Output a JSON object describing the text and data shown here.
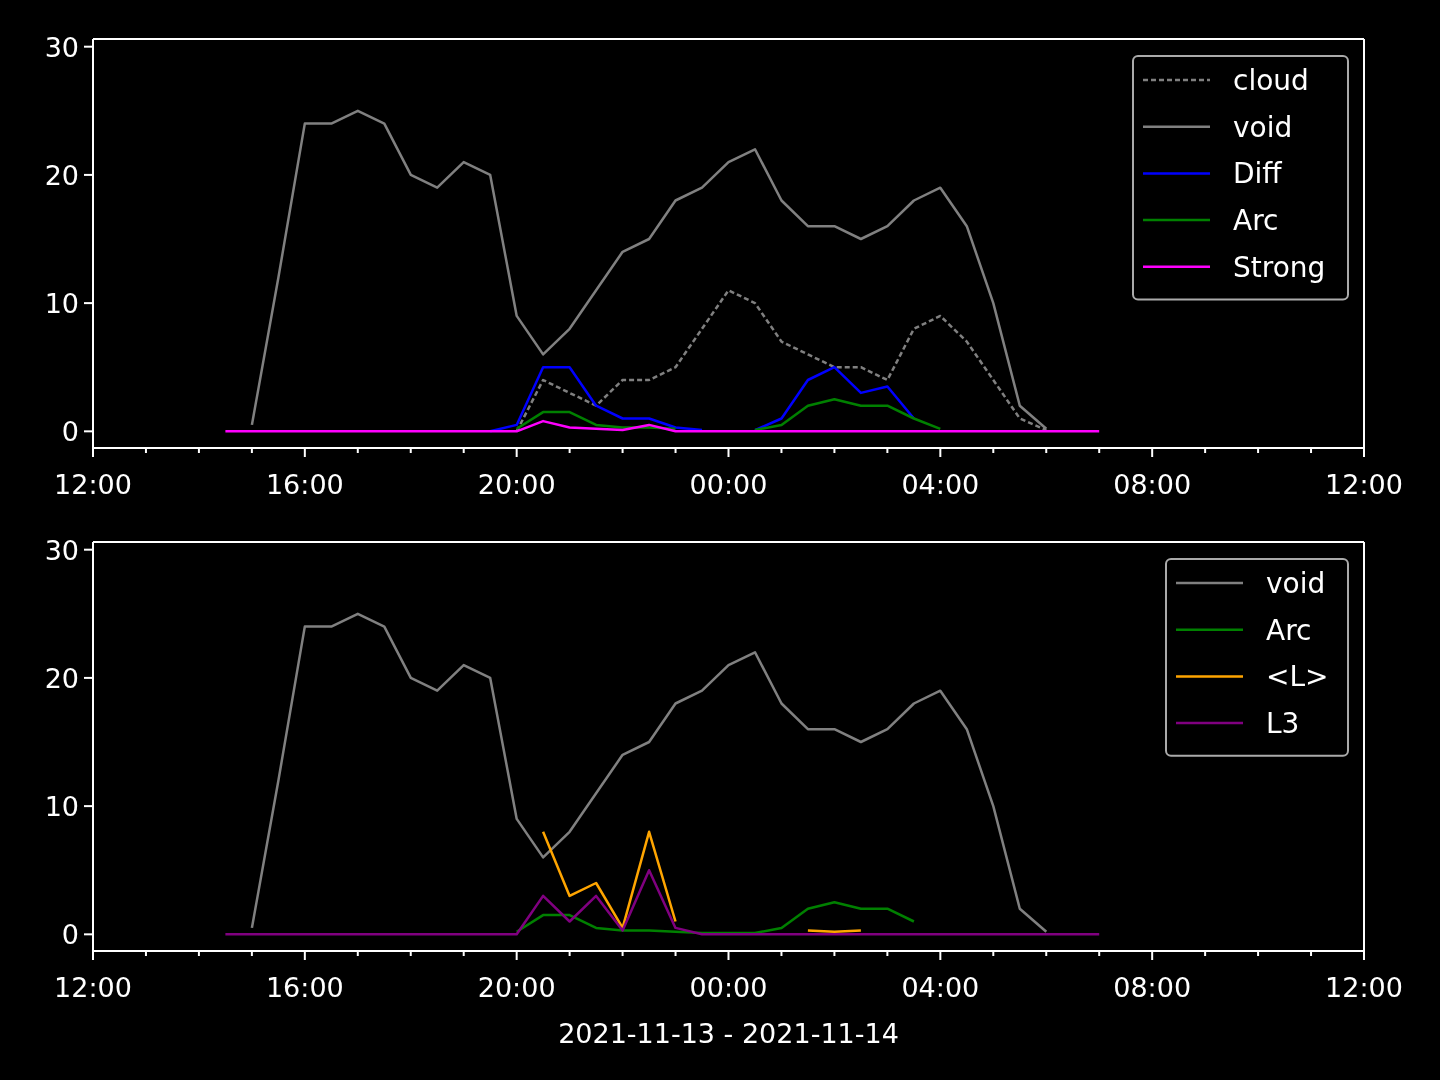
{
  "charts": [
    {
      "chart_data": {
        "type": "line",
        "ylim": [
          -1.3,
          30.6
        ],
        "legend": "upper right",
        "categories": [
          "12:00",
          null,
          null,
          null,
          null,
          null,
          null,
          null,
          "16:00",
          null,
          null,
          null,
          null,
          null,
          null,
          null,
          "20:00",
          null,
          null,
          null,
          null,
          null,
          null,
          null,
          "00:00",
          null,
          null,
          null,
          null,
          null,
          null,
          null,
          "04:00",
          null,
          null,
          null,
          null,
          null,
          null,
          null,
          "08:00",
          null,
          null,
          null,
          null,
          null,
          null,
          null,
          "12:00"
        ],
        "yticks": [
          0,
          10,
          20,
          30
        ],
        "series": [
          {
            "name": "cloud",
            "color": "#808080",
            "line_style": "dashed",
            "values": [
              null,
              null,
              null,
              null,
              null,
              null,
              null,
              null,
              null,
              null,
              null,
              null,
              null,
              null,
              null,
              null,
              0,
              4,
              3,
              2,
              4,
              4,
              5,
              8,
              11,
              10,
              7,
              6,
              5,
              5,
              4,
              8,
              9,
              7,
              4,
              1,
              0.1,
              null,
              null,
              null,
              null,
              null,
              null,
              null,
              null,
              null,
              null,
              null,
              null
            ]
          },
          {
            "name": "void",
            "color": "#808080",
            "line_style": "solid",
            "values": [
              null,
              null,
              null,
              null,
              null,
              null,
              0.5,
              12,
              24,
              24,
              25,
              24,
              20,
              19,
              21,
              20,
              9,
              6,
              8,
              11,
              14,
              15,
              18,
              19,
              21,
              22,
              18,
              16,
              16,
              15,
              16,
              18,
              19,
              16,
              10,
              2,
              0.2,
              null,
              null,
              null,
              null,
              null,
              null,
              null,
              null,
              null,
              null,
              null,
              null
            ]
          },
          {
            "name": "Diff",
            "color": "#0000ff",
            "line_style": "solid",
            "values": [
              null,
              null,
              null,
              null,
              null,
              null,
              null,
              null,
              null,
              null,
              null,
              null,
              null,
              null,
              null,
              0,
              0.5,
              5,
              5,
              2,
              1,
              1,
              0.3,
              0.1,
              null,
              0.1,
              1,
              4,
              5,
              3,
              3.5,
              1,
              null,
              null,
              null,
              null,
              null,
              null,
              null,
              null,
              null,
              null,
              null,
              null,
              null,
              null,
              null,
              null,
              null
            ]
          },
          {
            "name": "Arc",
            "color": "#008000",
            "line_style": "solid",
            "values": [
              null,
              null,
              null,
              null,
              null,
              null,
              null,
              null,
              null,
              null,
              null,
              null,
              null,
              null,
              null,
              null,
              0.2,
              1.5,
              1.5,
              0.5,
              0.3,
              0.3,
              0.2,
              null,
              null,
              0.1,
              0.5,
              2,
              2.5,
              2,
              2,
              1,
              0.2,
              null,
              null,
              null,
              null,
              null,
              null,
              null,
              null,
              null,
              null,
              null,
              null,
              null,
              null,
              null,
              null
            ]
          },
          {
            "name": "Strong",
            "color": "#ff00ff",
            "line_style": "solid",
            "values": [
              null,
              null,
              null,
              null,
              null,
              0,
              0,
              0,
              0,
              0,
              0,
              0,
              0,
              0,
              0,
              0,
              0,
              0.8,
              0.3,
              0.2,
              0.1,
              0.5,
              0,
              0,
              0,
              0,
              0,
              0,
              0,
              0,
              0,
              0,
              0,
              0,
              0,
              0,
              0,
              0,
              0,
              null,
              null,
              null,
              null,
              null,
              null,
              null,
              null,
              null,
              null
            ]
          }
        ]
      }
    },
    {
      "chart_data": {
        "type": "line",
        "xlabel": "2021-11-13 - 2021-11-14",
        "ylim": [
          -1.3,
          30.6
        ],
        "legend": "upper right",
        "categories": [
          "12:00",
          null,
          null,
          null,
          null,
          null,
          null,
          null,
          "16:00",
          null,
          null,
          null,
          null,
          null,
          null,
          null,
          "20:00",
          null,
          null,
          null,
          null,
          null,
          null,
          null,
          "00:00",
          null,
          null,
          null,
          null,
          null,
          null,
          null,
          "04:00",
          null,
          null,
          null,
          null,
          null,
          null,
          null,
          "08:00",
          null,
          null,
          null,
          null,
          null,
          null,
          null,
          "12:00"
        ],
        "yticks": [
          0,
          10,
          20,
          30
        ],
        "series": [
          {
            "name": "void",
            "color": "#808080",
            "line_style": "solid",
            "values": [
              null,
              null,
              null,
              null,
              null,
              null,
              0.5,
              12,
              24,
              24,
              25,
              24,
              20,
              19,
              21,
              20,
              9,
              6,
              8,
              11,
              14,
              15,
              18,
              19,
              21,
              22,
              18,
              16,
              16,
              15,
              16,
              18,
              19,
              16,
              10,
              2,
              0.2,
              null,
              null,
              null,
              null,
              null,
              null,
              null,
              null,
              null,
              null,
              null,
              null
            ]
          },
          {
            "name": "Arc",
            "color": "#008000",
            "line_style": "solid",
            "values": [
              null,
              null,
              null,
              null,
              null,
              null,
              null,
              null,
              null,
              null,
              null,
              null,
              null,
              null,
              null,
              null,
              0.2,
              1.5,
              1.5,
              0.5,
              0.3,
              0.3,
              0.2,
              0.1,
              0.1,
              0.1,
              0.5,
              2,
              2.5,
              2,
              2,
              1,
              null,
              null,
              null,
              null,
              null,
              null,
              null,
              null,
              null,
              null,
              null,
              null,
              null,
              null,
              null,
              null,
              null
            ]
          },
          {
            "name": "<L>",
            "color": "#ffa500",
            "line_style": "solid",
            "values": [
              null,
              null,
              null,
              null,
              null,
              null,
              null,
              null,
              null,
              null,
              null,
              null,
              null,
              null,
              null,
              null,
              null,
              8,
              3,
              4,
              0.5,
              8,
              1,
              null,
              null,
              null,
              null,
              0.3,
              0.2,
              0.3,
              null,
              null,
              null,
              null,
              null,
              null,
              null,
              null,
              null,
              null,
              null,
              null,
              null,
              null,
              null,
              null,
              null,
              null,
              null
            ]
          },
          {
            "name": "L3",
            "color": "#800080",
            "line_style": "solid",
            "values": [
              null,
              null,
              null,
              null,
              null,
              0,
              0,
              0,
              0,
              0,
              0,
              0,
              0,
              0,
              0,
              0,
              0,
              3,
              1,
              3,
              0.3,
              5,
              0.5,
              0,
              0,
              0,
              0,
              0,
              0,
              0,
              0,
              0,
              0,
              0,
              0,
              0,
              0,
              0,
              0,
              null,
              null,
              null,
              null,
              null,
              null,
              null,
              null,
              null,
              null
            ]
          }
        ]
      }
    }
  ]
}
